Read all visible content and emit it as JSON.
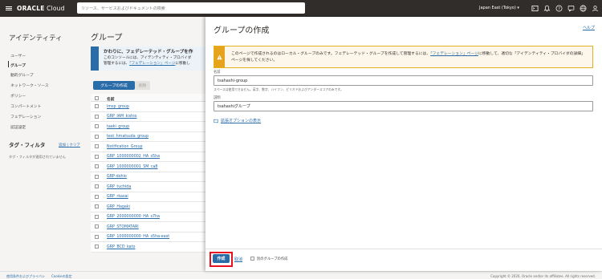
{
  "topbar": {
    "logo_bold": "ORACLE",
    "logo_rest": " Cloud",
    "search_placeholder": "リソース、サービスおよびドキュメントの検索",
    "region": "Japan East (Tokyo)"
  },
  "left_nav": {
    "title": "アイデンティティ",
    "items": [
      {
        "label": "ユーザー"
      },
      {
        "label": "グループ"
      },
      {
        "label": "動的グループ"
      },
      {
        "label": "ネットワーク・ソース"
      },
      {
        "label": "ポリシー"
      },
      {
        "label": "コンパートメント"
      },
      {
        "label": "フェデレーション"
      },
      {
        "label": "認証設定"
      }
    ],
    "active_index": 1,
    "tag_filter_title": "タグ・フィルタ",
    "tag_filter_add": "追加",
    "tag_filter_clear": "クリア",
    "tag_filter_empty": "タグ・フィルタが適用されていません"
  },
  "main": {
    "title": "グループ",
    "info_bold": "かわりに、フェデレーテッド・グループを作",
    "info_line1": "このコンソールには、アイデンティティ・プロバイダ",
    "info_line2_pre": "管理するには、",
    "info_line2_link": "「フェデレーション」ページ",
    "info_line2_post": "に移動し",
    "create_button": "グループの作成",
    "delete_button": "削除",
    "table_header_name": "名前",
    "rows": [
      "imsp_group",
      "GRP_IAM_kishio",
      "taeki_group",
      "test_hmatsuda_group",
      "Notification_Group",
      "GRP_1000000002_HA_s5ha",
      "GRP_1000000001_SM_ca8",
      "GRP-dohio",
      "GRP_tuchida",
      "GRP_rkasai",
      "GRP_Hagaki",
      "GRP_2000000000_HA_s7ha",
      "GRP_STOMATARI",
      "GRP_1000000000_HA_s5ha-east",
      "GRP_BCD_kato"
    ]
  },
  "panel": {
    "title": "グループの作成",
    "help": "ヘルプ",
    "warning_pre": "このページで作成されるのはローカル・グループのみです。フェデレーテッド・グループを作成して管理するには、",
    "warning_link1": "「フェデレーション」ページ",
    "warning_mid": "に移動して、適切な「アイデンティティ・プロバイダの詳細」ページを探してください。",
    "name_label": "名前",
    "name_value": "tsahashi-group",
    "name_help": "スペースは使用できません。英字、数字、ハイフン、ピリオドおよびアンダースコアのみです。",
    "desc_label": "説明",
    "desc_value": "tsahashiグループ",
    "advanced": "拡張オプションの表示",
    "create_button": "作成",
    "cancel": "取消",
    "another_label": "別のグループの作成"
  },
  "footer": {
    "terms": "使用条件およびプライバシ",
    "cookie": "Cookieの設定",
    "copyright": "Copyright © 2020, Oracle and/or its affiliates. All rights reserved."
  },
  "colors": {
    "accent": "#2a6ca8",
    "topbar": "#312d2a",
    "warning": "#e5a41b",
    "highlight": "#e8101f"
  }
}
